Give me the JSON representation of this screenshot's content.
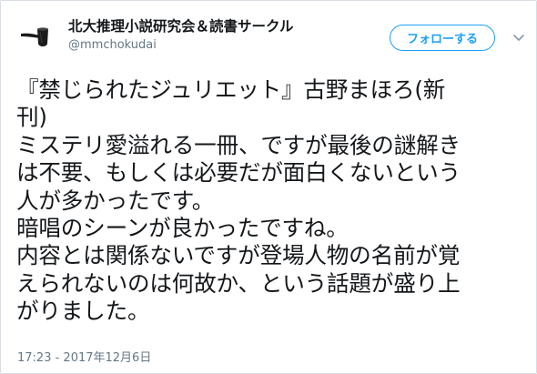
{
  "tweet": {
    "author": {
      "display_name": "北大推理小説研究会＆読書サークル",
      "screen_name": "@mmchokudai",
      "avatar_icon": "pipe-icon"
    },
    "follow_label": "フォローする",
    "menu_icon": "chevron-down-icon",
    "text_lines": [
      "『禁じられたジュリエット』古野まほろ(新",
      "刊)",
      "ミステリ愛溢れる一冊、ですが最後の謎解き",
      "は不要、もしくは必要だが面白くないという",
      "人が多かったです。",
      "暗唱のシーンが良かったですね。",
      "内容とは関係ないですが登場人物の名前が覚",
      "えられないのは何故か、という話題が盛り上",
      "がりました。"
    ],
    "timestamp": "17:23 - 2017年12月6日"
  },
  "colors": {
    "accent": "#1da1f2",
    "secondary_text": "#657786",
    "primary_text": "#14171a",
    "border": "#d8dde3"
  }
}
